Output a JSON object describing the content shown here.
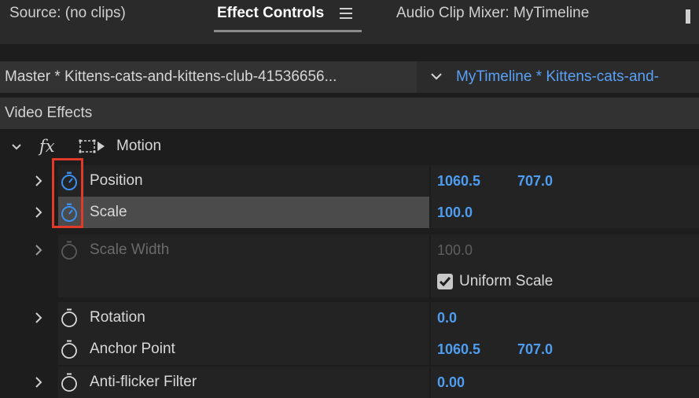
{
  "tabs": [
    {
      "label": "Source: (no clips)"
    },
    {
      "label": "Effect Controls"
    },
    {
      "label": "Audio Clip Mixer: MyTimeline"
    }
  ],
  "clip": {
    "master_label": "Master * Kittens-cats-and-kittens-club-41536656...",
    "sequence_label": "MyTimeline * Kittens-cats-and-"
  },
  "section": {
    "label": "Video Effects"
  },
  "motion": {
    "fx": "fx",
    "label": "Motion"
  },
  "properties": {
    "position": {
      "label": "Position",
      "value_x": "1060.5",
      "value_y": "707.0"
    },
    "scale": {
      "label": "Scale",
      "value": "100.0"
    },
    "scale_width": {
      "label": "Scale Width",
      "value": "100.0"
    },
    "uniform_scale": {
      "label": "Uniform Scale",
      "checked": true
    },
    "rotation": {
      "label": "Rotation",
      "value": "0.0"
    },
    "anchor_point": {
      "label": "Anchor Point",
      "value_x": "1060.5",
      "value_y": "707.0"
    },
    "anti_flicker": {
      "label": "Anti-flicker Filter",
      "value": "0.00"
    }
  },
  "colors": {
    "accent_blue": "#4e9df0",
    "highlight_red": "#e03a2a",
    "panel_bg": "#1d1d1d"
  }
}
